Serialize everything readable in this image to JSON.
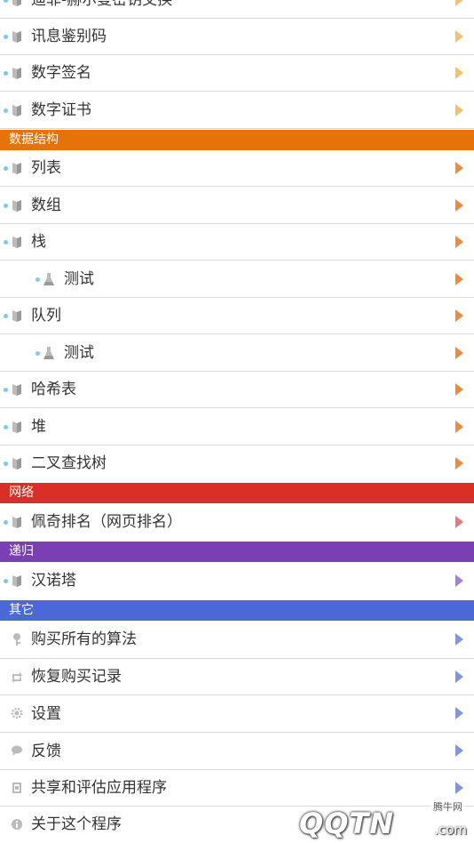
{
  "colors": {
    "dot": "#7ec8ee",
    "security_arrow": "#f5c06e",
    "data_structures": "#e6720a",
    "network": "#d83024",
    "recursion": "#7b3fb4",
    "other": "#4a68d6",
    "ds_arrow": "#ee8a3c",
    "net_arrow": "#e87878",
    "rec_arrow": "#a67fd9",
    "other_arrow": "#7d96e0"
  },
  "rows": [
    {
      "label": "迪菲-赫尔曼密钥交换",
      "icon": "book-icon",
      "arrow": "#f5c06e"
    },
    {
      "label": "讯息鉴别码",
      "icon": "book-icon",
      "arrow": "#f5c06e"
    },
    {
      "label": "数字签名",
      "icon": "book-icon",
      "arrow": "#f5c06e"
    },
    {
      "label": "数字证书",
      "icon": "book-icon",
      "arrow": "#f5c06e"
    },
    {
      "label": "列表",
      "icon": "book-icon",
      "arrow": "#ee8a3c"
    },
    {
      "label": "数组",
      "icon": "book-icon",
      "arrow": "#ee8a3c"
    },
    {
      "label": "栈",
      "icon": "book-icon",
      "arrow": "#ee8a3c"
    },
    {
      "label": "测试",
      "icon": "flask-icon",
      "arrow": "#ee8a3c"
    },
    {
      "label": "队列",
      "icon": "book-icon",
      "arrow": "#ee8a3c"
    },
    {
      "label": "测试",
      "icon": "flask-icon",
      "arrow": "#ee8a3c"
    },
    {
      "label": "哈希表",
      "icon": "book-icon",
      "arrow": "#ee8a3c"
    },
    {
      "label": "堆",
      "icon": "book-icon",
      "arrow": "#ee8a3c"
    },
    {
      "label": "二叉查找树",
      "icon": "book-icon",
      "arrow": "#ee8a3c"
    },
    {
      "label": "佩奇排名（网页排名）",
      "icon": "book-icon",
      "arrow": "#e87878"
    },
    {
      "label": "汉诺塔",
      "icon": "book-icon",
      "arrow": "#a67fd9"
    },
    {
      "label": "购买所有的算法",
      "icon": "key-icon",
      "arrow": "#7d96e0"
    },
    {
      "label": "恢复购买记录",
      "icon": "refresh-icon",
      "arrow": "#7d96e0"
    },
    {
      "label": "设置",
      "icon": "gear-icon",
      "arrow": "#7d96e0"
    },
    {
      "label": "反馈",
      "icon": "chat-bubble-icon",
      "arrow": "#7d96e0"
    },
    {
      "label": "共享和评估应用程序",
      "icon": "share-icon",
      "arrow": "#7d96e0"
    },
    {
      "label": "关于这个程序",
      "icon": "info-icon",
      "arrow": ""
    }
  ],
  "headers": {
    "data_structures": "数据结构",
    "network": "网络",
    "recursion": "递归",
    "other": "其它"
  },
  "watermark": {
    "small": "腾牛网",
    "big": "QQTN",
    "com": ".com"
  }
}
